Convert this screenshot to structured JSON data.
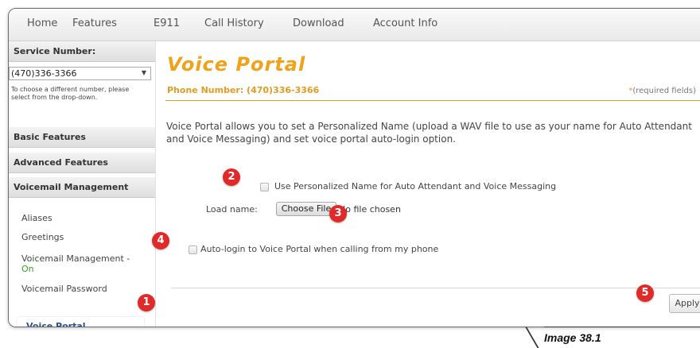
{
  "nav": {
    "items": [
      "Home",
      "Features",
      "E911",
      "Call History",
      "Download",
      "Account Info"
    ]
  },
  "sidebar": {
    "service_number_heading": "Service Number:",
    "selected_number": "(470)336-3366",
    "select_help": "To choose a different number, please select from the drop-down.",
    "sections": [
      "Basic Features",
      "Advanced Features",
      "Voicemail Management"
    ],
    "sub_items": [
      "Aliases",
      "Greetings",
      "Voicemail Management -",
      "On",
      "Voicemail Password"
    ],
    "active_item": "Voice Portal"
  },
  "main": {
    "title": "Voice Portal",
    "phone_label": "Phone Number: (470)336-3366",
    "required_star": "*",
    "required_note": "(required fields)",
    "description": "Voice Portal allows you to set a Personalized Name (upload a WAV file to use as your name for Auto Attendant and Voice Messaging) and set voice portal auto-login option.",
    "personalized_name_label": "Use Personalized Name for Auto Attendant and Voice Messaging",
    "personalized_name_checked": false,
    "load_name_label": "Load name:",
    "choose_file_button": "Choose File",
    "no_file_text": "No file chosen",
    "auto_login_label": "Auto-login to Voice Portal when calling from my phone",
    "auto_login_checked": false,
    "apply_button": "Apply"
  },
  "markers": [
    "1",
    "2",
    "3",
    "4",
    "5"
  ],
  "colors": {
    "accent": "#f0a21a",
    "marker": "#e02a2a",
    "on_status": "#3a9a2a"
  },
  "caption": "Image 38.1"
}
